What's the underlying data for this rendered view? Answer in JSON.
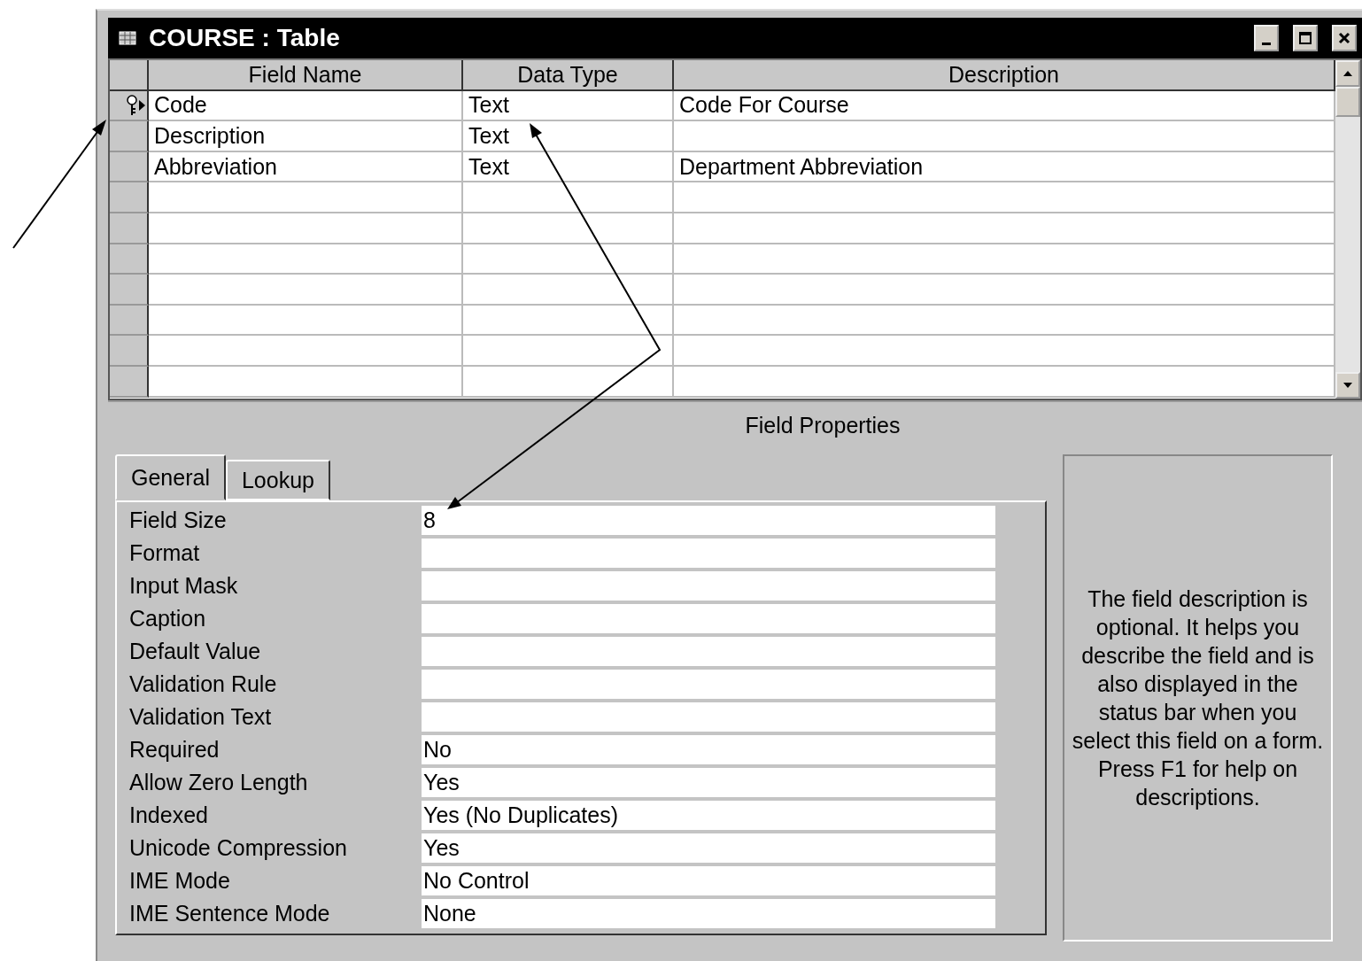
{
  "window": {
    "title": "COURSE : Table"
  },
  "table": {
    "columns": [
      "Field Name",
      "Data Type",
      "Description"
    ],
    "rows": [
      {
        "field_name": "Code",
        "data_type": "Text",
        "description": "Code For Course",
        "primary_key": true,
        "current": true
      },
      {
        "field_name": "Description",
        "data_type": "Text",
        "description": "",
        "primary_key": false,
        "current": false
      },
      {
        "field_name": "Abbreviation",
        "data_type": "Text",
        "description": "Department Abbreviation",
        "primary_key": false,
        "current": false
      }
    ]
  },
  "field_properties": {
    "title": "Field Properties",
    "tabs": [
      {
        "label": "General",
        "selected": true
      },
      {
        "label": "Lookup",
        "selected": false
      }
    ],
    "properties": [
      {
        "label": "Field Size",
        "value": "8"
      },
      {
        "label": "Format"
      },
      {
        "label": "Input Mask"
      },
      {
        "label": "Caption"
      },
      {
        "label": "Default Value"
      },
      {
        "label": "Validation Rule"
      },
      {
        "label": "Validation Text"
      },
      {
        "label": "Required",
        "value": "No"
      },
      {
        "label": "Allow Zero Length",
        "value": "Yes"
      },
      {
        "label": "Indexed",
        "value": "Yes (No Duplicates)"
      },
      {
        "label": "Unicode Compression",
        "value": "Yes"
      },
      {
        "label": "IME Mode",
        "value": "No Control"
      },
      {
        "label": "IME Sentence Mode",
        "value": "None"
      }
    ],
    "help_text": "The field description is optional.  It helps you describe the field and is also displayed in the status bar when you select this field on a form.  Press F1 for help on descriptions."
  }
}
